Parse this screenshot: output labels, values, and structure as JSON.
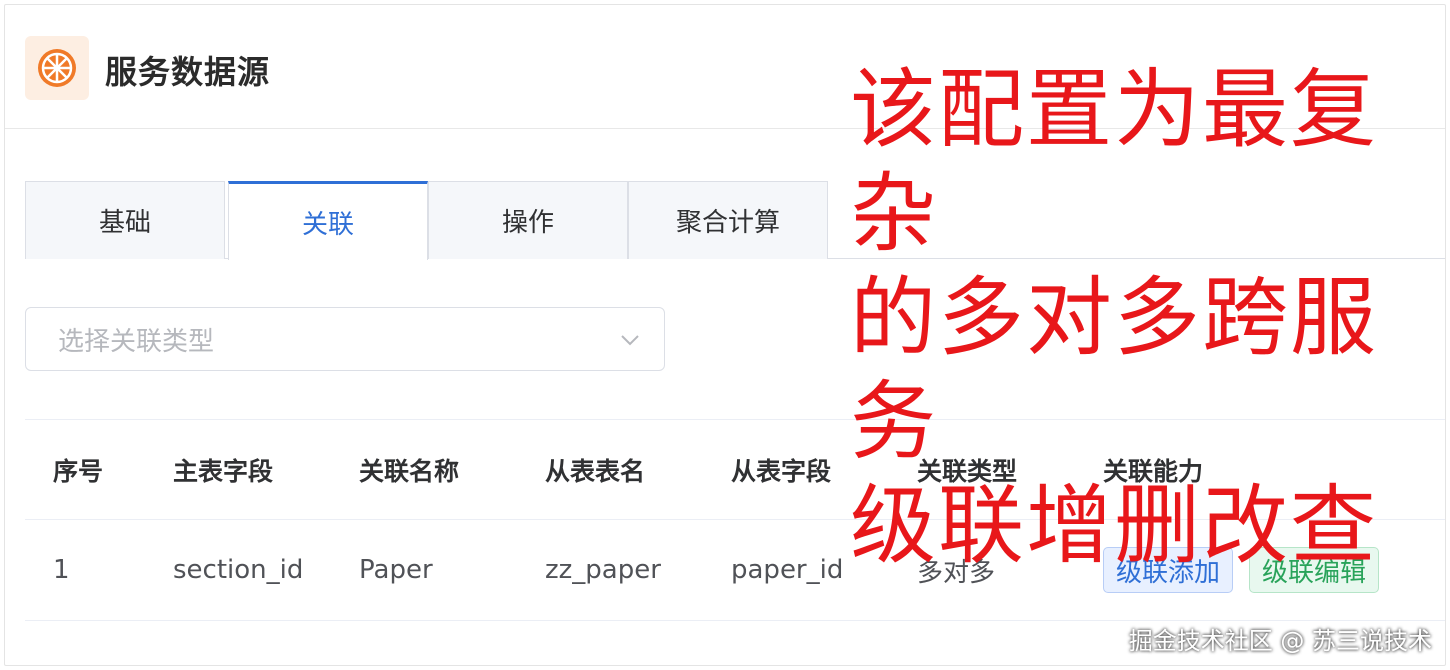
{
  "app": {
    "title": "服务数据源",
    "logo_icon": "orange-wheel-icon",
    "logo_color": "#f07a28"
  },
  "tabs": [
    {
      "label": "基础",
      "active": false
    },
    {
      "label": "关联",
      "active": true
    },
    {
      "label": "操作",
      "active": false
    },
    {
      "label": "聚合计算",
      "active": false
    }
  ],
  "relation_type_select": {
    "placeholder": "选择关联类型",
    "value": ""
  },
  "table": {
    "columns": [
      "序号",
      "主表字段",
      "关联名称",
      "从表表名",
      "从表字段",
      "关联类型",
      "关联能力"
    ],
    "rows": [
      {
        "index": "1",
        "main_field": "section_id",
        "relation_name": "Paper",
        "sub_table": "zz_paper",
        "sub_field": "paper_id",
        "relation_type": "多对多",
        "abilities": [
          "级联添加",
          "级联编辑"
        ]
      }
    ]
  },
  "annotation": {
    "lines": [
      "该配置为最复杂",
      "的多对多跨服务",
      "级联增删改查"
    ],
    "color": "#e8171a"
  },
  "watermark": "掘金技术社区 @ 苏三说技术",
  "colors": {
    "accent": "#2f6fd6",
    "success": "#29a35a"
  }
}
